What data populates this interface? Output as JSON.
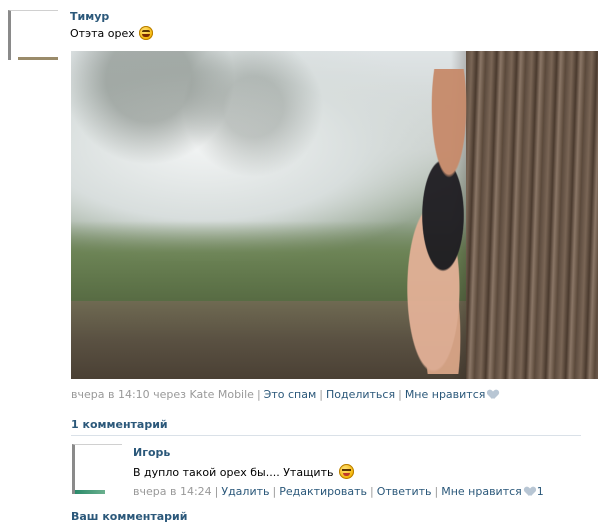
{
  "post": {
    "author": "Тимур",
    "text": "Отэта орех",
    "emoji": "grin-emoji",
    "meta": {
      "time": "вчера в 14:10 через Kate Mobile",
      "spam": "Это спам",
      "share": "Поделиться",
      "like": "Мне нравится"
    },
    "comments_count": "1 комментарий"
  },
  "comments": [
    {
      "author": "Игорь",
      "text": "В дупло такой орех бы.... Утащить",
      "emoji": "wink-emoji",
      "meta": {
        "time": "вчера в 14:24",
        "delete": "Удалить",
        "edit": "Редактировать",
        "reply": "Ответить",
        "like": "Мне нравится",
        "like_count": "1"
      }
    }
  ],
  "reply_box": {
    "label": "Ваш комментарий"
  },
  "colors": {
    "link": "#2b587a",
    "meta": "#999999",
    "divider": "#dae1e8",
    "heart": "#b8c6d4"
  }
}
